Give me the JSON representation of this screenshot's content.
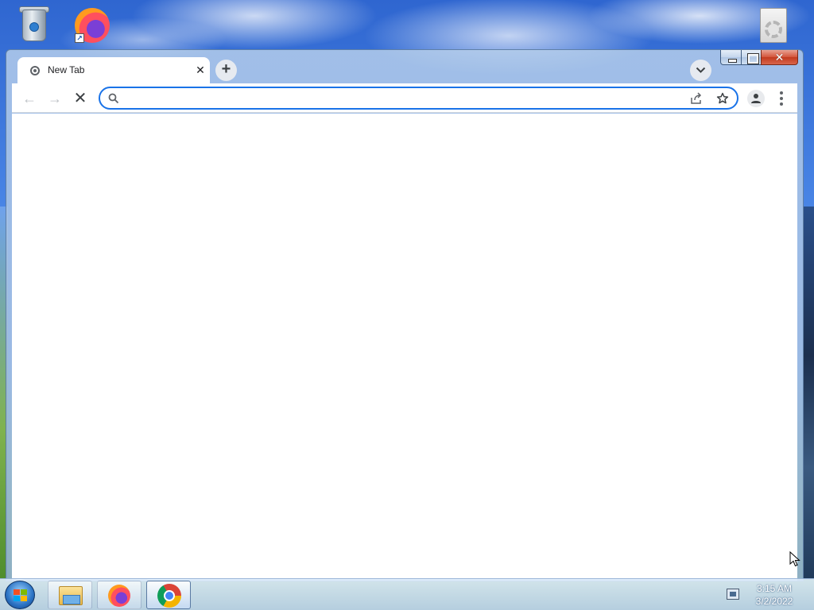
{
  "desktop": {
    "icons": [
      "recycle-bin-icon",
      "firefox-icon",
      "document-gear-icon"
    ]
  },
  "browser": {
    "tab": {
      "title": "New Tab",
      "close_glyph": "✕"
    },
    "new_tab_glyph": "+",
    "caption": {
      "close_glyph": "✕"
    },
    "toolbar": {
      "back_glyph": "←",
      "forward_glyph": "→",
      "stop_glyph": "✕",
      "omnibox_value": ""
    },
    "accent": "#1a73e8"
  },
  "taskbar": {
    "apps": [
      "explorer",
      "firefox",
      "chrome"
    ],
    "clock": {
      "time": "3:15 AM",
      "date": "3/2/2022"
    }
  }
}
